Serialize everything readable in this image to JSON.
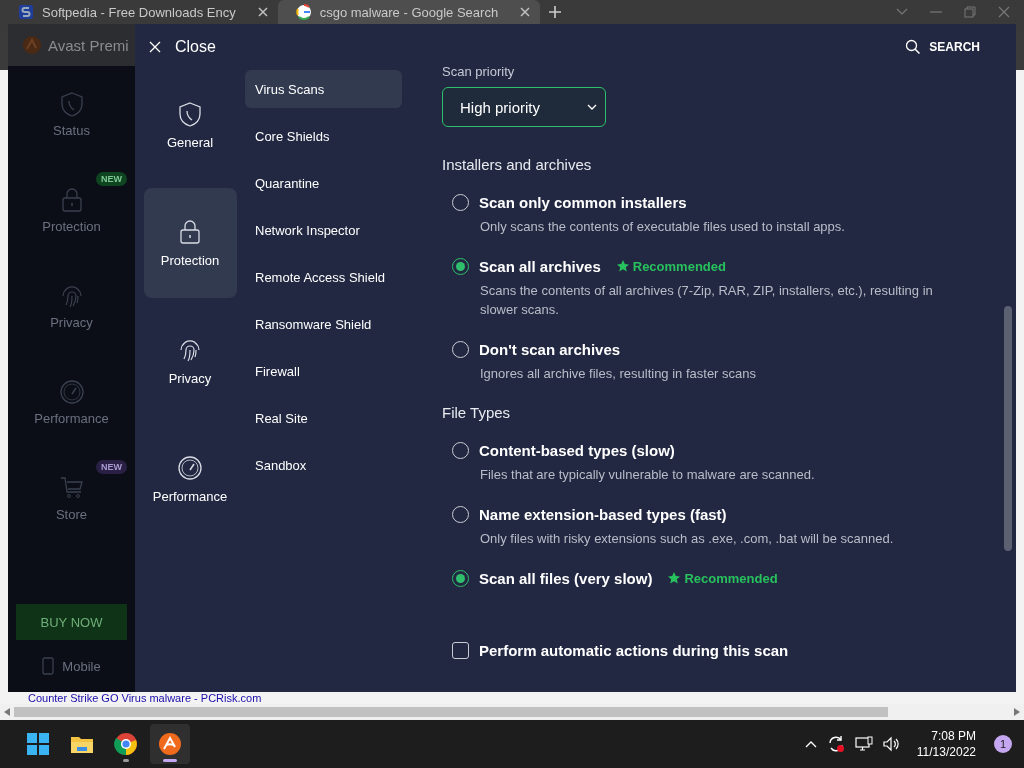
{
  "browser": {
    "tabs": [
      {
        "title": "Softpedia - Free Downloads Ency",
        "selected": false
      },
      {
        "title": "csgo malware - Google Search",
        "selected": true
      }
    ],
    "page_link": "Counter Strike GO Virus malware - PCRisk.com"
  },
  "avast": {
    "title": "Avast Premi",
    "nav": [
      {
        "label": "Status"
      },
      {
        "label": "Protection",
        "badge": "NEW"
      },
      {
        "label": "Privacy"
      },
      {
        "label": "Performance"
      },
      {
        "label": "Store",
        "badge": "NEW"
      }
    ],
    "buy_button": "BUY NOW",
    "mobile": "Mobile"
  },
  "settings": {
    "close": "Close",
    "search": "SEARCH",
    "categories": [
      {
        "label": "General",
        "selected": false
      },
      {
        "label": "Protection",
        "selected": true
      },
      {
        "label": "Privacy",
        "selected": false
      },
      {
        "label": "Performance",
        "selected": false
      }
    ],
    "sections": [
      {
        "label": "Virus Scans",
        "selected": true
      },
      {
        "label": "Core Shields",
        "selected": false
      },
      {
        "label": "Quarantine",
        "selected": false
      },
      {
        "label": "Network Inspector",
        "selected": false
      },
      {
        "label": "Remote Access Shield",
        "selected": false
      },
      {
        "label": "Ransomware Shield",
        "selected": false
      },
      {
        "label": "Firewall",
        "selected": false
      },
      {
        "label": "Real Site",
        "selected": false
      },
      {
        "label": "Sandbox",
        "selected": false
      }
    ],
    "content": [
      {
        "kind": "label",
        "text": "Scan priority"
      },
      {
        "kind": "dropdown",
        "value": "High priority"
      },
      {
        "kind": "heading",
        "text": "Installers and archives"
      },
      {
        "kind": "radio",
        "label": "Scan only common installers",
        "selected": false,
        "description": "Only scans the contents of executable files used to install apps."
      },
      {
        "kind": "radio",
        "label": "Scan all archives",
        "selected": true,
        "badge": "Recommended",
        "description": "Scans the contents of all archives (7-Zip, RAR, ZIP, installers, etc.), resulting in slower scans."
      },
      {
        "kind": "radio",
        "label": "Don't scan archives",
        "selected": false,
        "description": "Ignores all archive files, resulting in faster scans"
      },
      {
        "kind": "heading",
        "text": "File Types"
      },
      {
        "kind": "radio",
        "label": "Content-based types (slow)",
        "selected": false,
        "description": "Files that are typically vulnerable to malware are scanned."
      },
      {
        "kind": "radio",
        "label": "Name extension-based types (fast)",
        "selected": false,
        "description": "Only files with risky extensions such as .exe, .com, .bat will be scanned."
      },
      {
        "kind": "radio",
        "label": "Scan all files (very slow)",
        "selected": true,
        "badge": "Recommended"
      },
      {
        "kind": "checkbox",
        "label": "Perform automatic actions during this scan",
        "checked": false
      }
    ]
  },
  "taskbar": {
    "apps": [
      {
        "running": false,
        "active": false
      },
      {
        "running": false,
        "active": false
      },
      {
        "running": true,
        "active": false
      },
      {
        "running": true,
        "active": true
      }
    ],
    "time": "7:08 PM",
    "date": "11/13/2022",
    "notifications": "1"
  }
}
